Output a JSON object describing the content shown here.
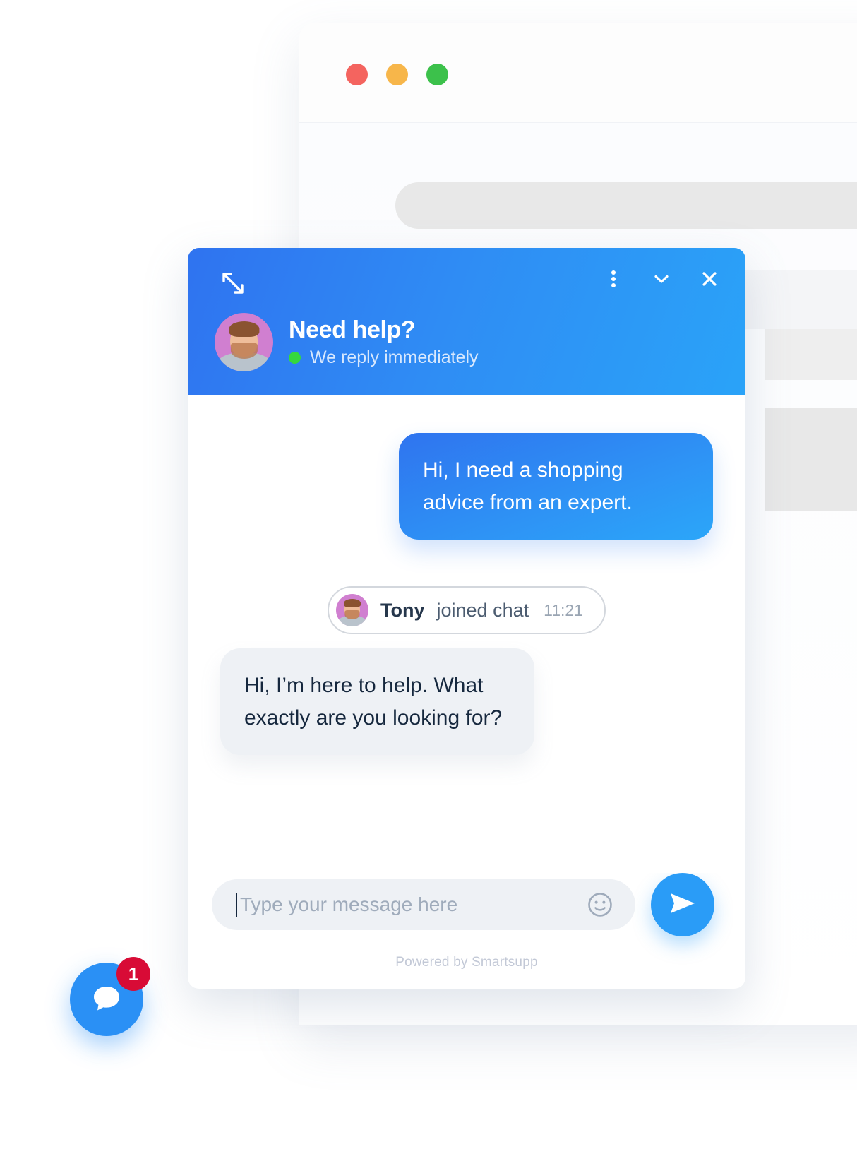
{
  "browser_mock": {
    "traffic_lights": [
      {
        "name": "close",
        "color": "#f4645f"
      },
      {
        "name": "minimize",
        "color": "#f7b64a"
      },
      {
        "name": "maximize",
        "color": "#3cc14b"
      }
    ]
  },
  "widget": {
    "header": {
      "title": "Need help?",
      "status": "We reply immediately",
      "status_color": "#35d83c",
      "expand_icon": "expand-arrows-icon",
      "menu_icon": "kebab-menu-icon",
      "minimize_icon": "chevron-down-icon",
      "close_icon": "close-icon",
      "avatar_alt": "agent-avatar"
    },
    "messages": [
      {
        "direction": "out",
        "text": "Hi, I need a shopping advice from an expert."
      },
      {
        "direction": "system",
        "name": "Tony",
        "label": "joined chat",
        "time": "11:21"
      },
      {
        "direction": "in",
        "text": "Hi, I’m here to help. What exactly are you looking for?"
      }
    ],
    "composer": {
      "placeholder": "Type your message here",
      "value": "",
      "emoji_icon": "smiley-face-icon",
      "send_icon": "send-paper-plane-icon"
    },
    "footer": {
      "powered_by": "Powered by Smartsupp"
    }
  },
  "launcher": {
    "icon": "chat-bubble-icon",
    "badge_count": "1",
    "badge_color": "#d80b36",
    "color": "#2a90f5"
  }
}
